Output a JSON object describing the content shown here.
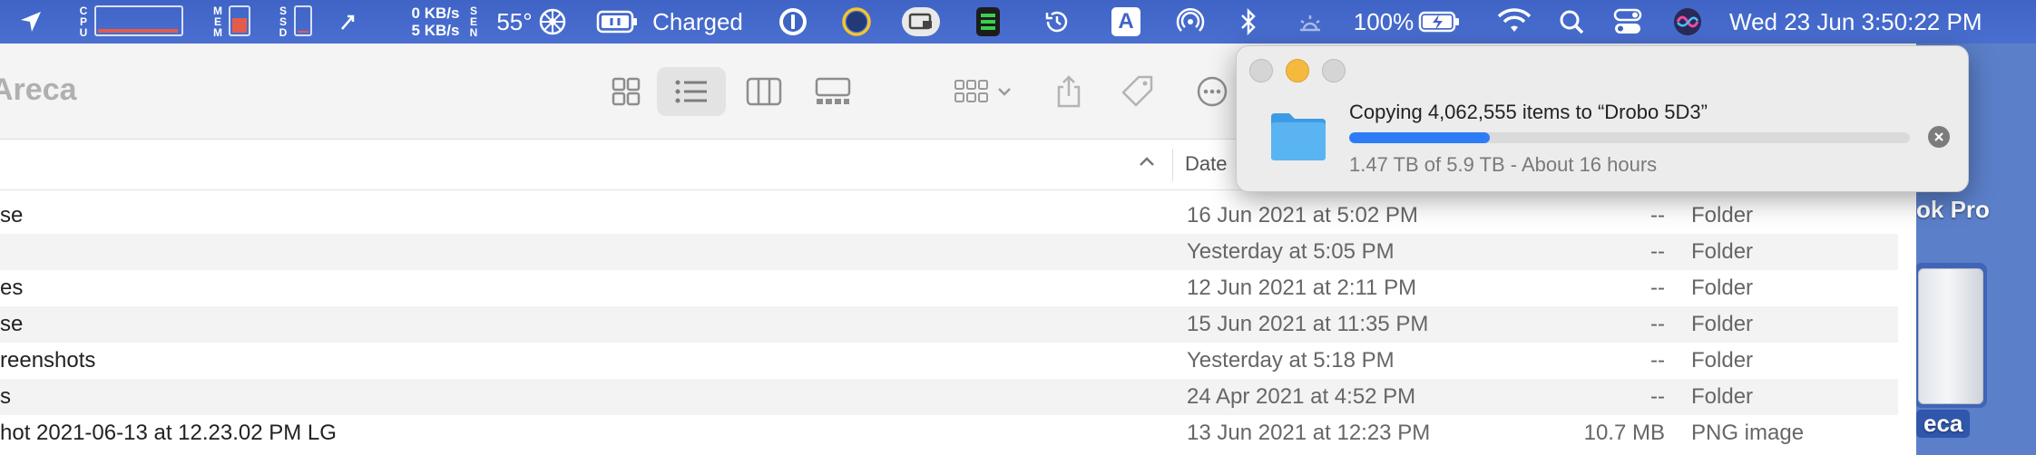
{
  "menubar": {
    "cpu_label": [
      "C",
      "P",
      "U"
    ],
    "mem_label": [
      "M",
      "E",
      "M"
    ],
    "ssd_label": [
      "S",
      "S",
      "D"
    ],
    "net_up": "0 KB/s",
    "net_down": "5 KB/s",
    "sensor_label": [
      "S",
      "E",
      "N"
    ],
    "temperature": "55°",
    "battery_status_app": "Charged",
    "battery_percent": "100%",
    "clock": "Wed 23 Jun  3:50:22 PM",
    "input_source": "A",
    "icons": [
      "location-arrow-icon",
      "fan-icon",
      "battery-plug-icon",
      "onepassword-icon",
      "circle-ring-icon",
      "screen-share-icon",
      "istat-icon",
      "time-machine-icon",
      "input-source-icon",
      "airdrop-icon",
      "bluetooth-icon",
      "brightness-icon",
      "battery-icon",
      "wifi-icon",
      "spotlight-icon",
      "control-center-icon",
      "siri-icon"
    ]
  },
  "finder": {
    "title": "Areca",
    "column_date": "Date",
    "rows": [
      {
        "name": "se",
        "date": "16 Jun 2021 at 5:02 PM",
        "size": "--",
        "kind": "Folder"
      },
      {
        "name": "",
        "date": "Yesterday at 5:05 PM",
        "size": "--",
        "kind": "Folder"
      },
      {
        "name": "es",
        "date": "12 Jun 2021 at 2:11 PM",
        "size": "--",
        "kind": "Folder"
      },
      {
        "name": "se",
        "date": "15 Jun 2021 at 11:35 PM",
        "size": "--",
        "kind": "Folder"
      },
      {
        "name": "reenshots",
        "date": "Yesterday at 5:18 PM",
        "size": "--",
        "kind": "Folder"
      },
      {
        "name": "s",
        "date": "24 Apr 2021 at 4:52 PM",
        "size": "--",
        "kind": "Folder"
      },
      {
        "name": "hot 2021-06-13 at 12.23.02 PM LG",
        "date": "13 Jun 2021 at 12:23 PM",
        "size": "10.7 MB",
        "kind": "PNG image"
      }
    ]
  },
  "desktop": {
    "item_top_label": "ok Pro",
    "item_bottom_label": "eca"
  },
  "copy_dialog": {
    "title": "Copying 4,062,555 items to “Drobo 5D3”",
    "status": "1.47 TB of 5.9 TB - About 16 hours",
    "progress": 0.25,
    "accent": "#2d7cf6"
  }
}
